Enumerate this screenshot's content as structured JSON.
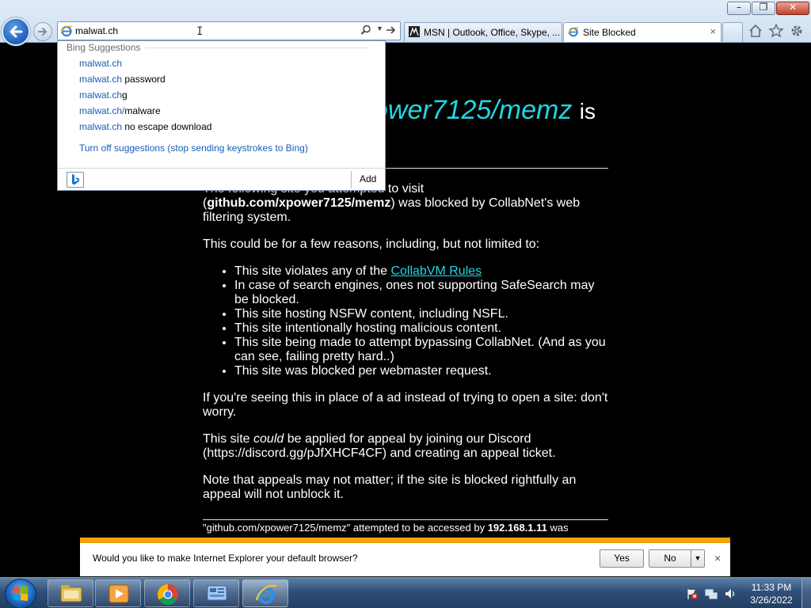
{
  "browser": {
    "address_value": "malwat.ch",
    "tabs": [
      {
        "title": "MSN | Outlook, Office, Skype, ..."
      },
      {
        "title": "Site Blocked",
        "close": "×"
      }
    ]
  },
  "suggestions": {
    "header": "Bing Suggestions",
    "items": [
      {
        "match": "malwat.ch",
        "rest": ""
      },
      {
        "match": "malwat.ch",
        "rest": " password"
      },
      {
        "match": "malwat.ch",
        "rest": "g"
      },
      {
        "match": "malwat.ch/",
        "rest": "malware"
      },
      {
        "match": "malwat.ch",
        "rest": " no escape download"
      }
    ],
    "turn_off": "Turn off suggestions (stop sending keystrokes to Bing)",
    "add": "Add"
  },
  "page": {
    "heading_fragment": "ower7125/memz",
    "heading_is": "is",
    "intro_pre": "The following site you attempted to visit",
    "intro_url": "github.com/xpower7125/memz",
    "intro_post": ") was blocked by CollabNet's web filtering system.",
    "reasons_intro": "This could be for a few reasons, including, but not limited to:",
    "reason_rules_pre": "This site violates any of the ",
    "reason_rules_link": "CollabVM Rules",
    "reasons": [
      "In case of search engines, ones not supporting SafeSearch may be blocked.",
      "This site hosting NSFW content, including NSFL.",
      "This site intentionally hosting malicious content.",
      "This site being made to attempt bypassing CollabNet. (And as you can see, failing pretty hard..)",
      "This site was blocked per webmaster request."
    ],
    "ad_note": "If you're seeing this in place of a ad instead of trying to open a site: don't worry.",
    "appeal_pre": "This site ",
    "appeal_could": "could",
    "appeal_post": " be applied for appeal by joining our Discord (https://discord.gg/pJfXHCF4CF) and creating an appeal ticket.",
    "appeal_note": "Note that appeals may not matter; if the site is blocked rightfully an appeal will not unblock it.",
    "footer_pre": "\"github.com/xpower7125/memz\" attempted to be accessed by ",
    "footer_ip": "192.168.1.11",
    "footer_post": " was"
  },
  "notification": {
    "message": "Would you like to make Internet Explorer your default browser?",
    "yes": "Yes",
    "no": "No",
    "close": "×"
  },
  "taskbar": {
    "time": "11:33 PM",
    "date": "3/26/2022"
  },
  "colors": {
    "accent_cyan": "#22d6e0",
    "notif_bar": "#f0a30a",
    "link_blue": "#1a5eb6"
  }
}
